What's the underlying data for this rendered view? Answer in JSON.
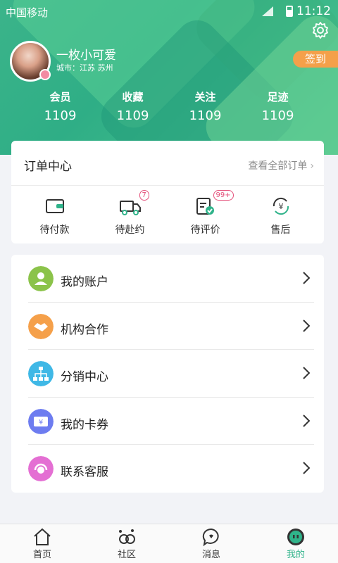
{
  "status_bar": {
    "carrier": "中国移动",
    "time": "11:12"
  },
  "profile": {
    "name": "一枚小可爱",
    "city": "城市：江苏 苏州",
    "checkin_label": "签到"
  },
  "stats": [
    {
      "label": "会员",
      "value": "1109"
    },
    {
      "label": "收藏",
      "value": "1109"
    },
    {
      "label": "关注",
      "value": "1109"
    },
    {
      "label": "足迹",
      "value": "1109"
    }
  ],
  "order_center": {
    "title": "订单中心",
    "view_all": "查看全部订单",
    "items": [
      {
        "label": "待付款",
        "icon": "wallet-icon",
        "badge": ""
      },
      {
        "label": "待赴约",
        "icon": "truck-icon",
        "badge": "7"
      },
      {
        "label": "待评价",
        "icon": "review-clipboard-icon",
        "badge": "99+"
      },
      {
        "label": "售后",
        "icon": "yen-refresh-icon",
        "badge": ""
      }
    ]
  },
  "menu": [
    {
      "label": "我的账户",
      "icon": "account-icon",
      "color": "#8bc34a"
    },
    {
      "label": "机构合作",
      "icon": "handshake-icon",
      "color": "#f5a04a"
    },
    {
      "label": "分销中心",
      "icon": "distribution-tree-icon",
      "color": "#3fb8e6"
    },
    {
      "label": "我的卡券",
      "icon": "coupon-icon",
      "color": "#6d7cf0"
    },
    {
      "label": "联系客服",
      "icon": "customer-service-icon",
      "color": "#e46fd3"
    }
  ],
  "tabs": [
    {
      "label": "首页",
      "icon": "home-icon"
    },
    {
      "label": "社区",
      "icon": "community-icon"
    },
    {
      "label": "消息",
      "icon": "message-icon"
    },
    {
      "label": "我的",
      "icon": "profile-icon",
      "active": true
    }
  ],
  "colors": {
    "accent": "#2fb38a",
    "checkin": "#f4a04a",
    "badge": "#e4507a"
  }
}
